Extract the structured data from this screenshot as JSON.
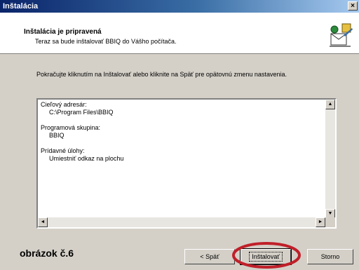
{
  "window": {
    "title": "Inštalácia",
    "close_glyph": "×"
  },
  "header": {
    "title": "Inštalácia je pripravená",
    "subtitle": "Teraz sa bude inštalovať BBIQ do Vášho počítača."
  },
  "body": {
    "intro": "Pokračujte kliknutím na Inštalovať alebo kliknite na Späť pre opätovnú zmenu nastavenia."
  },
  "summary": {
    "target_label": "Cieľový adresár:",
    "target_value": "C:\\Program Files\\BBIQ",
    "group_label": "Programová skupina:",
    "group_value": "BBIQ",
    "tasks_label": "Prídavné úlohy:",
    "tasks_value": "Umiestniť odkaz na plochu"
  },
  "buttons": {
    "back": "< Späť",
    "install": "Inštalovať",
    "cancel": "Storno"
  },
  "caption": "obrázok č.6",
  "colors": {
    "titlebar": "#0a246a",
    "annotation_circle": "#c0202a"
  },
  "icons": [
    "install-wizard-icon",
    "close-icon",
    "scroll-up-icon",
    "scroll-down-icon",
    "scroll-left-icon",
    "scroll-right-icon"
  ]
}
